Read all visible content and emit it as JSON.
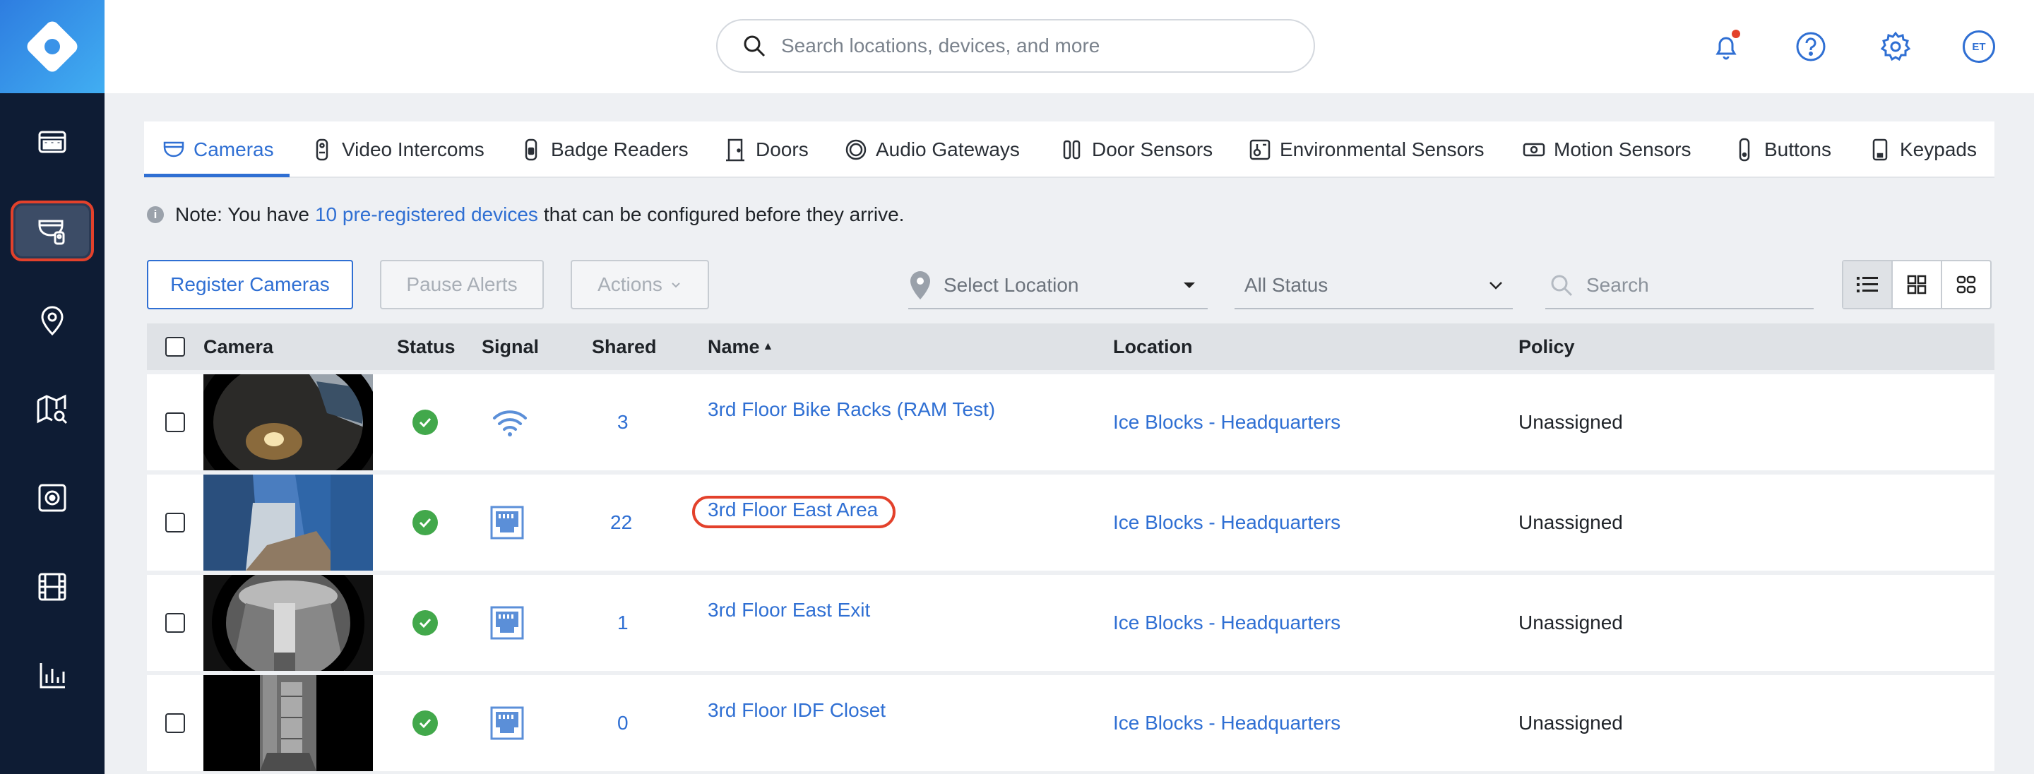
{
  "header": {
    "search_placeholder": "Search locations, devices, and more",
    "avatar_initials": "ET"
  },
  "sidebar": {
    "items": [
      {
        "name": "dashboard-icon"
      },
      {
        "name": "devices-icon",
        "active": true
      },
      {
        "name": "location-pin-icon"
      },
      {
        "name": "map-search-icon"
      },
      {
        "name": "safe-icon"
      },
      {
        "name": "film-icon"
      },
      {
        "name": "bar-chart-icon"
      }
    ]
  },
  "tabs": [
    {
      "label": "Cameras",
      "active": true
    },
    {
      "label": "Video Intercoms"
    },
    {
      "label": "Badge Readers"
    },
    {
      "label": "Doors"
    },
    {
      "label": "Audio Gateways"
    },
    {
      "label": "Door Sensors"
    },
    {
      "label": "Environmental Sensors"
    },
    {
      "label": "Motion Sensors"
    },
    {
      "label": "Buttons"
    },
    {
      "label": "Keypads"
    }
  ],
  "note": {
    "prefix": "Note: You have",
    "link": "10 pre-registered devices",
    "suffix": "that can be configured before they arrive."
  },
  "toolbar": {
    "register_label": "Register Cameras",
    "pause_label": "Pause Alerts",
    "actions_label": "Actions",
    "location_placeholder": "Select Location",
    "status_value": "All Status",
    "search_placeholder": "Search"
  },
  "table": {
    "columns": {
      "camera": "Camera",
      "status": "Status",
      "signal": "Signal",
      "shared": "Shared",
      "name": "Name",
      "name_sort": "▲",
      "location": "Location",
      "policy": "Policy"
    },
    "rows": [
      {
        "shared": "3",
        "name": "3rd Floor Bike Racks (RAM Test)",
        "location": "Ice Blocks - Headquarters",
        "policy": "Unassigned",
        "signal": "wifi"
      },
      {
        "shared": "22",
        "name": "3rd Floor East Area",
        "location": "Ice Blocks - Headquarters",
        "policy": "Unassigned",
        "signal": "ethernet"
      },
      {
        "shared": "1",
        "name": "3rd Floor East Exit",
        "location": "Ice Blocks - Headquarters",
        "policy": "Unassigned",
        "signal": "ethernet"
      },
      {
        "shared": "0",
        "name": "3rd Floor IDF Closet",
        "location": "Ice Blocks - Headquarters",
        "policy": "Unassigned",
        "signal": "ethernet"
      }
    ]
  },
  "colors": {
    "accent": "#2f6fd3",
    "sidebar": "#0e1c34",
    "highlight": "#e3412b",
    "status_ok": "#42a84b"
  }
}
